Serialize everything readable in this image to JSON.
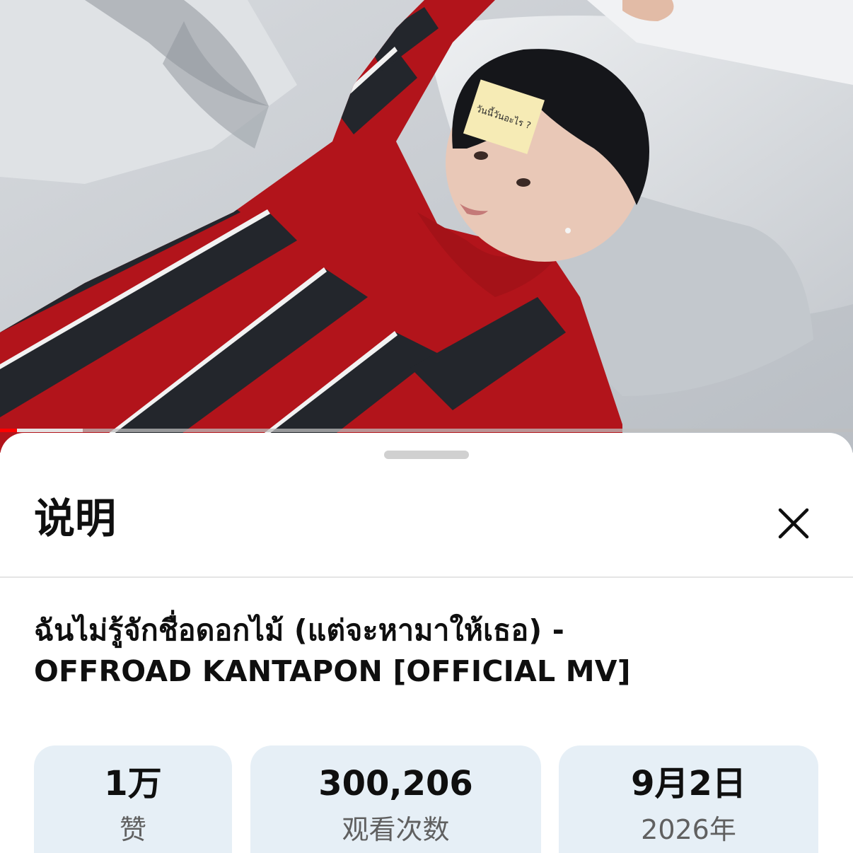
{
  "video": {
    "progress_fraction": 0.02,
    "buffered_fraction": 0.097,
    "sticky_note_text": "วันนี้วันอะไร ?"
  },
  "sheet": {
    "title": "说明",
    "close_icon": "close-icon"
  },
  "description": {
    "title_line_1": "ฉันไม่รู้จักชื่อดอกไม้ (แต่จะหามาให้เธอ) -",
    "title_line_2": "OFFROAD KANTAPON [OFFICIAL MV]"
  },
  "stats": {
    "likes_value": "1万",
    "likes_label": "赞",
    "views_value": "300,206",
    "views_label": "观看次数",
    "date_value": "9月2日",
    "date_label": "2026年"
  },
  "colors": {
    "accent": "#ff0000",
    "chip_background": "#e6eff6",
    "text_primary": "#0f0f0f",
    "text_secondary": "#606060"
  }
}
